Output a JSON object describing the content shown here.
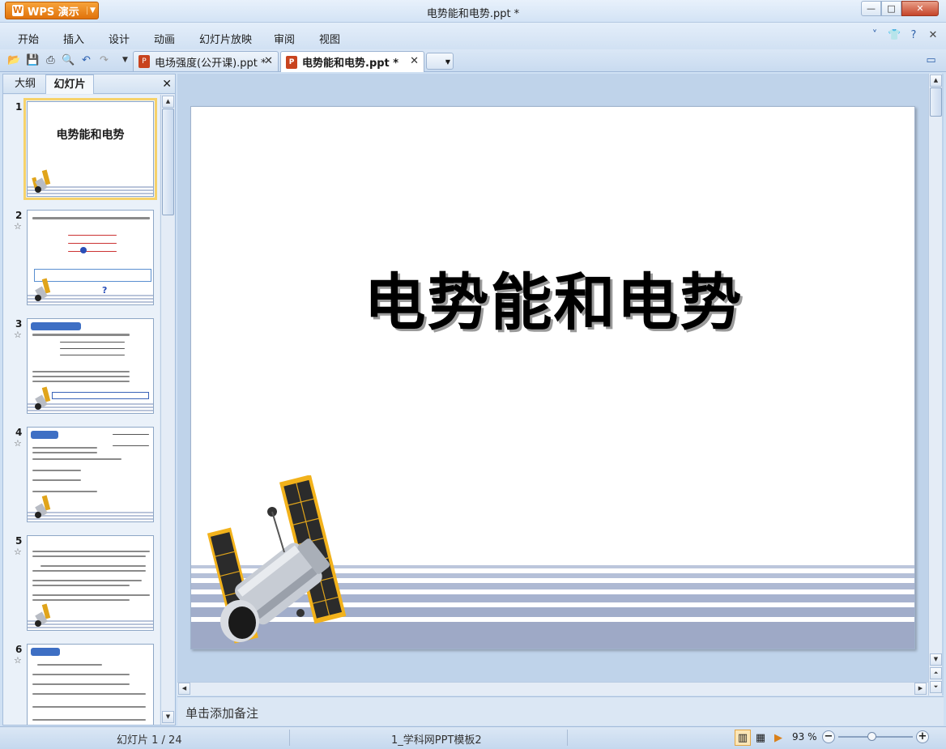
{
  "window": {
    "app_label": "WPS 演示",
    "title": "电势能和电势.ppt *",
    "min": "—",
    "max": "□",
    "close": "✕"
  },
  "menu": {
    "items": [
      "开始",
      "插入",
      "设计",
      "动画",
      "幻灯片放映",
      "审阅",
      "视图"
    ]
  },
  "tabs": [
    {
      "label": "电场强度(公开课).ppt *",
      "active": false
    },
    {
      "label": "电势能和电势.ppt *",
      "active": true
    }
  ],
  "new_tab_label": "+",
  "left_pane": {
    "tab_outline": "大纲",
    "tab_slides": "幻灯片",
    "close": "✕",
    "thumbnails": [
      {
        "num": "1",
        "title": "电势能和电势",
        "star": ""
      },
      {
        "num": "2",
        "title": "",
        "star": "☆"
      },
      {
        "num": "3",
        "title": "",
        "star": "☆"
      },
      {
        "num": "4",
        "title": "",
        "star": "☆"
      },
      {
        "num": "5",
        "title": "",
        "star": "☆"
      },
      {
        "num": "6",
        "title": "",
        "star": "☆"
      }
    ]
  },
  "slide": {
    "title": "电势能和电势"
  },
  "notes_placeholder": "单击添加备注",
  "status": {
    "slide_count": "幻灯片 1 / 24",
    "template": "1_学科网PPT模板2",
    "zoom": "93 %"
  },
  "colors": {
    "accent": "#3e6fc4",
    "app_button": "#e0720b",
    "selection": "#f6d26a"
  }
}
